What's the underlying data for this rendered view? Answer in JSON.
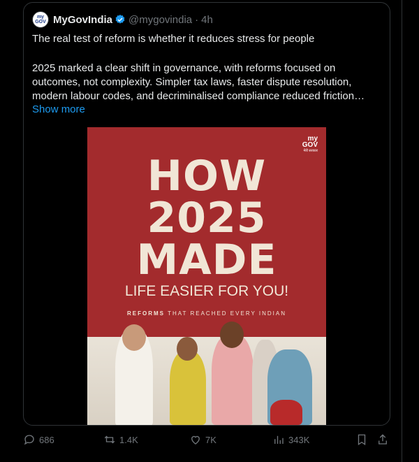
{
  "tweet": {
    "author_name": "MyGovIndia",
    "handle": "@mygovindia",
    "time": "4h",
    "headline": "The real test of reform is whether it reduces stress for people",
    "body_lines": [
      "2025 marked a clear shift in governance, with reforms focused on",
      "outcomes, not complexity. Simpler tax laws, faster dispute resolution,",
      "modern labour codes, and decriminalised compliance reduced friction…"
    ],
    "show_more": "Show more",
    "avatar_text": "my GOV"
  },
  "media": {
    "logo_top": "my",
    "logo_bottom": "GOV",
    "logo_small": "मेरी सरकार",
    "line1": "HOW",
    "line2": "2025",
    "line3": "MADE",
    "line4": "LIFE EASIER FOR YOU!",
    "tag_bold": "REFORMS",
    "tag_rest": " THAT REACHED EVERY INDIAN",
    "bg_color": "#a32b2d",
    "text_color": "#f1e6d6"
  },
  "actions": {
    "replies": "686",
    "reposts": "1.4K",
    "likes": "7K",
    "views": "343K"
  },
  "colors": {
    "link": "#1d9bf0",
    "muted": "#71767b",
    "verified": "#1d9bf0"
  }
}
